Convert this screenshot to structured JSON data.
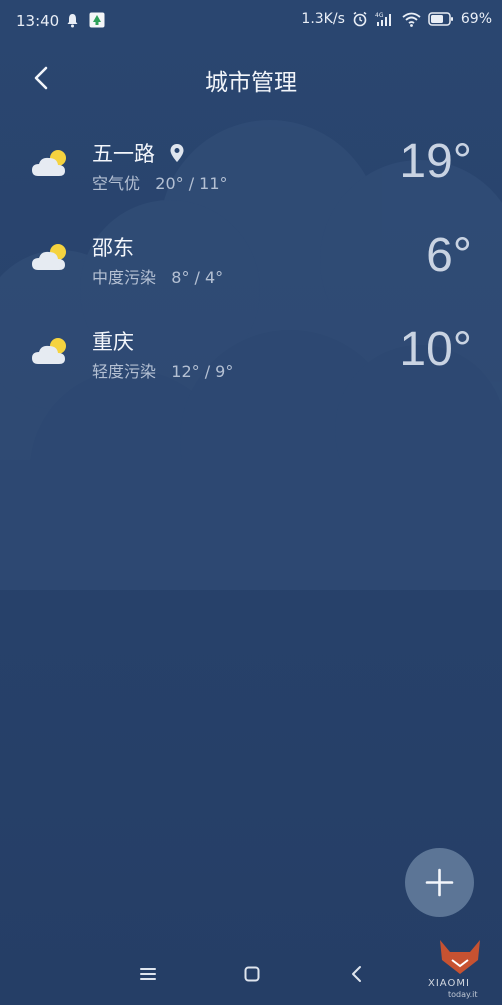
{
  "status_bar": {
    "time": "13:40",
    "speed": "1.3K/s",
    "battery": "69%",
    "network": "4G"
  },
  "header": {
    "title": "城市管理"
  },
  "cities": [
    {
      "name": "五一路",
      "detail": "空气优   20° / 11°",
      "temp": "19°",
      "located": true
    },
    {
      "name": "邵东",
      "detail": "中度污染   8° / 4°",
      "temp": "6°",
      "located": false
    },
    {
      "name": "重庆",
      "detail": "轻度污染   12° / 9°",
      "temp": "10°",
      "located": false
    }
  ],
  "watermark": {
    "brand": "XIAOMI",
    "site": "today.it"
  },
  "colors": {
    "background": "#27416a",
    "cloud": "#2f4a72",
    "fab": "#5c7596",
    "sun": "#f5d33f"
  }
}
